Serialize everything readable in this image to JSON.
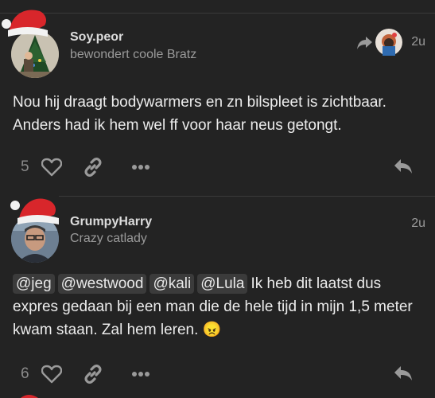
{
  "posts": [
    {
      "username": "Soy.peor",
      "user_title": "bewondert coole Bratz",
      "time": "2u",
      "body": "Nou hij draagt bodywarmers en zn bilspleet is zichtbaar. Anders had ik hem wel ff voor haar neus getongt.",
      "likes": "5",
      "has_reply_to": true
    },
    {
      "username": "GrumpyHarry",
      "user_title": "Crazy catlady",
      "time": "2u",
      "mentions": [
        "@jeg",
        "@westwood",
        "@kali",
        "@Lula"
      ],
      "body": "Ik heb dit laatst dus expres gedaan bij een man die de hele tijd in mijn 1,5 meter kwam staan. Zal hem leren. 😠",
      "likes": "6"
    }
  ],
  "colors": {
    "background": "#232323",
    "text": "#ececec",
    "muted": "#9a9a9a",
    "hat_red": "#d8262b"
  }
}
